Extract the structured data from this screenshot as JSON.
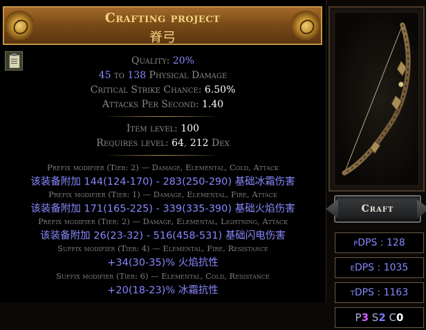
{
  "header": {
    "title": "Crafting project",
    "item_name": "脊弓"
  },
  "properties": {
    "quality_label": "Quality: ",
    "quality_value": "20%",
    "phys_min": "45",
    "phys_to": " to ",
    "phys_max": "138",
    "phys_label": " Physical Damage",
    "crit_label": "Critical Strike Chance: ",
    "crit_value": "6.50%",
    "aps_label": "Attacks Per Second: ",
    "aps_value": "1.40"
  },
  "requirements": {
    "ilvl_label": "Item level: ",
    "ilvl_value": "100",
    "req_label": "Requires level: ",
    "req_level": "64",
    "req_sep": ", ",
    "req_dex": "212",
    "req_dex_label": " Dex"
  },
  "modifiers": [
    {
      "label": "Prefix modifier (Tier: 2) — Damage, Elemental, Cold, Attack",
      "text": "该装备附加 144(124-170) - 283(250-290) 基础冰霜伤害"
    },
    {
      "label": "Prefix modifier (Tier: 1) — Damage, Elemental, Fire, Attack",
      "text": "该装备附加 171(165-225) - 339(335-390) 基础火焰伤害"
    },
    {
      "label": "Prefix modifier (Tier: 2) — Damage, Elemental, Lightning, Attack",
      "text": "该装备附加 26(23-32) - 516(458-531) 基础闪电伤害"
    },
    {
      "label": "Suffix modifier (Tier: 4) — Elemental, Fire, Resistance",
      "text": "+34(30-35)% 火焰抗性"
    },
    {
      "label": "Suffix modifier (Tier: 6) — Elemental, Cold, Resistance",
      "text": "+20(18-23)% 冰霜抗性"
    }
  ],
  "actions": {
    "craft_label": "Craft"
  },
  "dps": {
    "pdps_label": "pDPS",
    "pdps_sep": " : ",
    "pdps_value": "128",
    "edps_label": "eDPS",
    "edps_sep": " : ",
    "edps_value": "1035",
    "tdps_label": "tDPS",
    "tdps_sep": " : ",
    "tdps_value": "1163"
  },
  "sockets": {
    "p_label": "P",
    "p_value": "3",
    "s_label": "S",
    "s_value": "2",
    "c_label": "C",
    "c_value": "0"
  },
  "colors": {
    "magic": "#8888ff",
    "header_text": "#f2d37f",
    "label_grey": "#7f7f7f"
  },
  "icons": {
    "clipboard": "clipboard-icon",
    "bow": "bow-icon"
  }
}
